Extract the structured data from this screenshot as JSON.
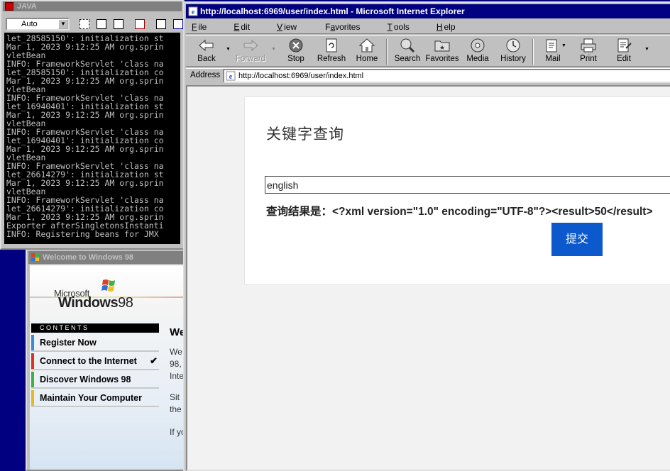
{
  "java": {
    "title": "JAVA",
    "combo_value": "Auto",
    "console_lines": [
      "let_28585150': initialization st",
      "Mar 1, 2023 9:12:25 AM org.sprin",
      "vletBean",
      "INFO: FrameworkServlet 'class na",
      "let_28585150': initialization co",
      "Mar 1, 2023 9:12:25 AM org.sprin",
      "vletBean",
      "INFO: FrameworkServlet 'class na",
      "let_16940401': initialization st",
      "Mar 1, 2023 9:12:25 AM org.sprin",
      "vletBean",
      "INFO: FrameworkServlet 'class na",
      "let_16940401': initialization co",
      "Mar 1, 2023 9:12:25 AM org.sprin",
      "vletBean",
      "INFO: FrameworkServlet 'class na",
      "let_26614279': initialization st",
      "Mar 1, 2023 9:12:25 AM org.sprin",
      "vletBean",
      "INFO: FrameworkServlet 'class na",
      "let_26614279': initialization co",
      "Mar 1, 2023 9:12:25 AM org.sprin",
      "Exporter afterSingletonsInstanti",
      "INFO: Registering beans for JMX "
    ]
  },
  "welcome": {
    "title": "Welcome to Windows 98",
    "logo_microsoft": "Microsoft",
    "logo_windows": "Windows",
    "logo_98": "98",
    "contents_header": "CONTENTS",
    "menu": [
      {
        "label": "Register Now",
        "color": "#3a8ad8"
      },
      {
        "label": "Connect to the Internet",
        "color": "#e03020",
        "checked": "✔"
      },
      {
        "label": "Discover Windows 98",
        "color": "#40b040"
      },
      {
        "label": "Maintain Your Computer",
        "color": "#e8b820"
      }
    ],
    "right_heading": "We",
    "right_lines": [
      "We",
      "98,",
      "Inte",
      "Sit",
      "the",
      "If yo"
    ]
  },
  "ie": {
    "title": "http://localhost:6969/user/index.html - Microsoft Internet Explorer",
    "menu": [
      "File",
      "Edit",
      "View",
      "Favorites",
      "Tools",
      "Help"
    ],
    "menu_access": [
      "F",
      "E",
      "V",
      "a",
      "T",
      "H"
    ],
    "toolbar": {
      "back": "Back",
      "forward": "Forward",
      "stop": "Stop",
      "refresh": "Refresh",
      "home": "Home",
      "search": "Search",
      "favorites": "Favorites",
      "media": "Media",
      "history": "History",
      "mail": "Mail",
      "print": "Print",
      "edit": "Edit"
    },
    "address_label": "Address",
    "address_url": "http://localhost:6969/user/index.html"
  },
  "page": {
    "title": "关键字查询",
    "keyword_value": "english",
    "result_text": "查询结果是：<?xml version=\"1.0\" encoding=\"UTF-8\"?><result>50</result>",
    "submit_label": "提交",
    "accent_color": "#0b59cc"
  }
}
